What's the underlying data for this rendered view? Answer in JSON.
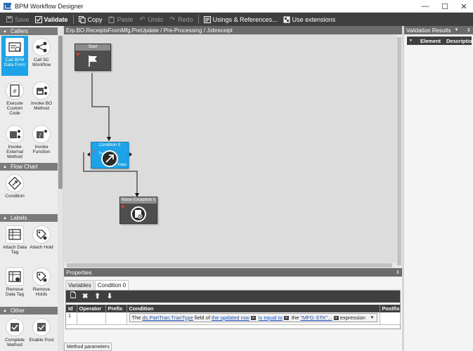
{
  "window": {
    "title": "BPM Workflow Designer",
    "minimize": "—",
    "maximize": "☐",
    "close": "✕"
  },
  "toolbar": {
    "save": "Save",
    "validate": "Validate",
    "copy": "Copy",
    "paste": "Paste",
    "undo": "Undo",
    "redo": "Redo",
    "usings": "Usings & References...",
    "extensions": "Use extensions"
  },
  "palette": {
    "sections": {
      "callers": "Callers",
      "flow_chart": "Flow Chart",
      "labels": "Labels",
      "other": "Other"
    },
    "tools": {
      "call_bpm": "Call BPM Data Form",
      "call_sc": "Call SC Workflow",
      "execute_code": "Execute Custom Code",
      "invoke_bo": "Invoke BO Method",
      "invoke_external": "Invoke External Method",
      "invoke_function": "Invoke Function",
      "condition": "Condition",
      "attach_tag": "Attach Data Tag",
      "attach_hold": "Attach Hold",
      "remove_tag": "Remove Data Tag",
      "remove_holds": "Remove Holds",
      "complete_method": "Complete Method",
      "enable_post": "Enable Post"
    }
  },
  "canvas": {
    "breadcrumb": "Erp.BO.ReceiptsFromMfg.PreUpdate / Pre-Processing / Jobreceipt",
    "activities": {
      "start": "Start",
      "condition": "Condition 0",
      "condition_true": "True",
      "condition_false": "False",
      "raise": "Raise Exception 0"
    }
  },
  "properties": {
    "header": "Properties",
    "tabs": [
      "Variables",
      "Condition 0"
    ],
    "columns": [
      "Id",
      "Operator",
      "Prefix",
      "Condition",
      "Postfix"
    ],
    "row": {
      "id": "1",
      "operator": "",
      "prefix": "",
      "postfix": "",
      "condition": {
        "the": "The",
        "field_link": "ds.PartTran.TranType",
        "field_of": "field of",
        "row_link": "the updated row",
        "op_link": "is equal to",
        "the2": "the",
        "value_link": "\"MFG-STK\"...",
        "expression": "expression"
      }
    },
    "method_tab": "Method parameters"
  },
  "validation": {
    "header": "Validation Results",
    "columns": [
      "Element",
      "Description"
    ]
  },
  "colors": {
    "accent": "#1fa3e8",
    "toolbar": "#3f3f3f",
    "link": "#1a52c6"
  }
}
